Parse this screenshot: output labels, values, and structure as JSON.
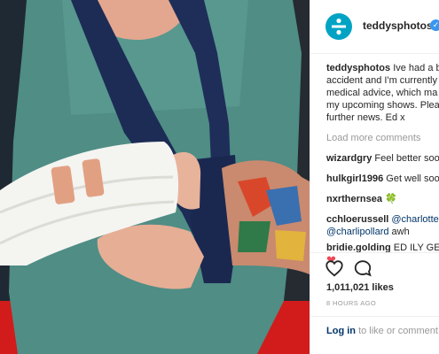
{
  "post": {
    "username": "teddysphotos",
    "verified": "✓",
    "image_alt": "photo",
    "caption": {
      "username": "teddysphotos",
      "lines": [
        "Ive had a b",
        "accident and I'm currently",
        "medical advice, which ma",
        "my upcoming shows. Plea",
        "further news. Ed x"
      ]
    },
    "load_more": "Load more comments",
    "comments": [
      {
        "user": "wizardgry",
        "text": "Feel better soo"
      },
      {
        "user": "hulkgirl1996",
        "text": "Get well soo"
      },
      {
        "user": "nxrthernsea",
        "text": "🍀"
      },
      {
        "user": "cchloerussell",
        "text": "@charlotte",
        "text2_mention": "@charlipollard",
        "text2": "awh"
      },
      {
        "user": "bridie.golding",
        "text": "ED ILY GE",
        "text2": "❤"
      }
    ],
    "likes": "1,011,021 likes",
    "time": "8 HOURS AGO",
    "login": {
      "link": "Log in",
      "rest": "to like or comment"
    },
    "icons": {
      "like": "heart-icon",
      "comment": "comment-icon",
      "avatar": "divide-logo-icon"
    },
    "colors": {
      "avatar": "#00a3c4",
      "link": "#003569",
      "muted": "#999999",
      "verified": "#3897f0",
      "heart": "#ed4956"
    }
  }
}
